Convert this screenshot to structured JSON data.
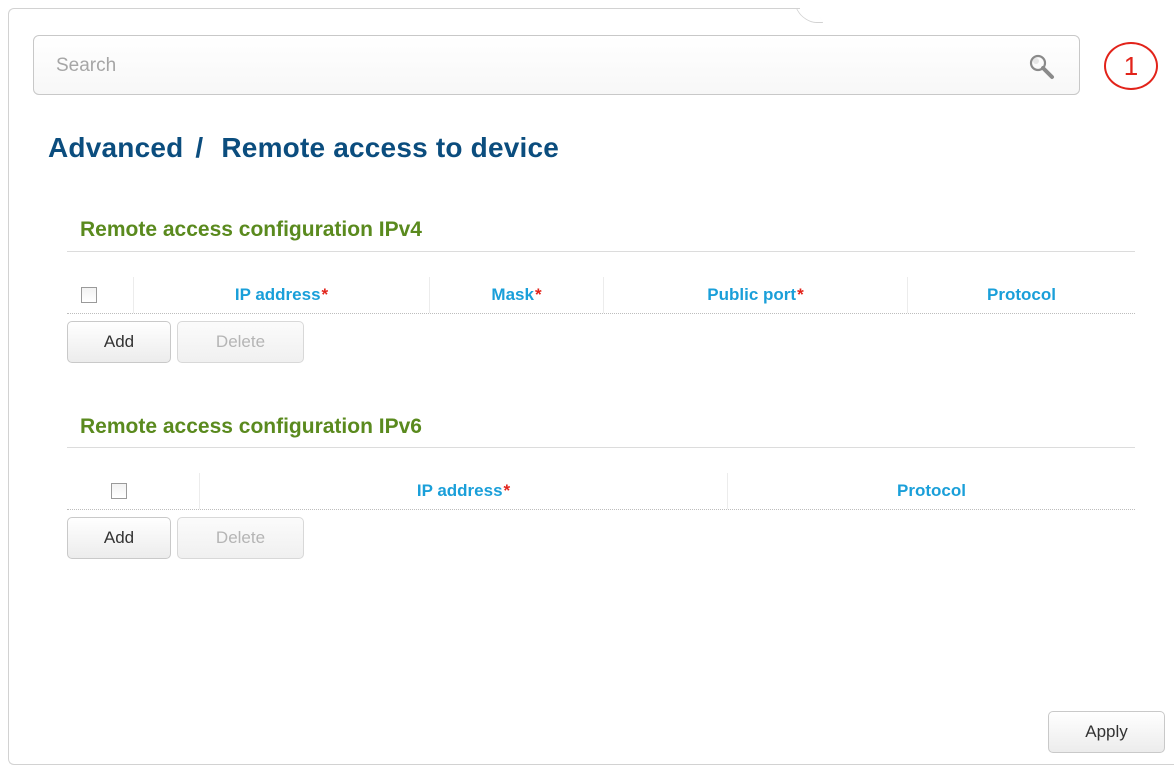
{
  "search": {
    "placeholder": "Search"
  },
  "notification": {
    "count": "1"
  },
  "breadcrumb": {
    "section": "Advanced",
    "separator": "/",
    "page": "Remote access to device"
  },
  "ipv4": {
    "title": "Remote access configuration IPv4",
    "columns": [
      {
        "label": "IP address",
        "required": "*"
      },
      {
        "label": "Mask",
        "required": "*"
      },
      {
        "label": "Public port",
        "required": "*"
      },
      {
        "label": "Protocol",
        "required": ""
      }
    ],
    "add_label": "Add",
    "delete_label": "Delete"
  },
  "ipv6": {
    "title": "Remote access configuration IPv6",
    "columns": [
      {
        "label": "IP address",
        "required": "*"
      },
      {
        "label": "Protocol",
        "required": ""
      }
    ],
    "add_label": "Add",
    "delete_label": "Delete"
  },
  "footer": {
    "apply_label": "Apply"
  },
  "colors": {
    "title": "#0b4d7e",
    "section": "#5a8a1e",
    "header": "#1a9fd9",
    "required": "#e2231a",
    "badge": "#e2231a"
  }
}
